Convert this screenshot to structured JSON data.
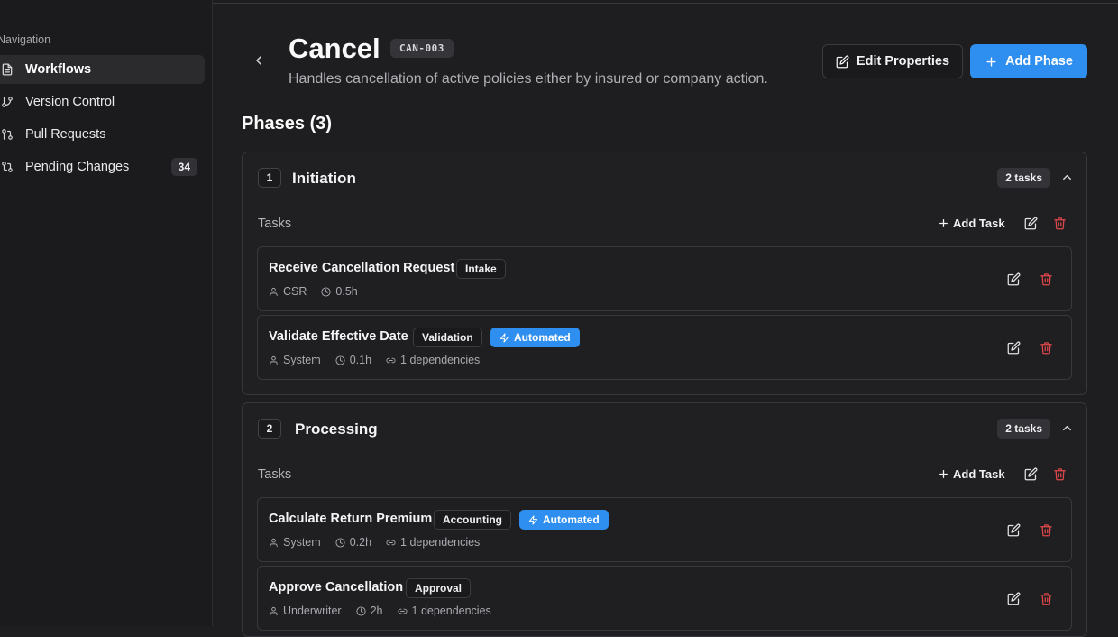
{
  "sidebar": {
    "heading": "Navigation",
    "items": [
      {
        "label": "Workflows",
        "icon": "document-icon",
        "active": true
      },
      {
        "label": "Version Control",
        "icon": "git-branch-icon"
      },
      {
        "label": "Pull Requests",
        "icon": "git-pull-request-icon"
      },
      {
        "label": "Pending Changes",
        "icon": "git-compare-icon",
        "badge": "34"
      }
    ]
  },
  "header": {
    "title": "Cancel",
    "code": "CAN-003",
    "description": "Handles cancellation of active policies either by insured or company action.",
    "edit_label": "Edit Properties",
    "add_label": "Add Phase"
  },
  "phases_title": "Phases (3)",
  "phases": [
    {
      "number": "1",
      "name": "Initiation",
      "count": "2 tasks",
      "tasks_label": "Tasks",
      "add_task_label": "Add Task",
      "tasks": [
        {
          "name": "Receive Cancellation Request",
          "tag": "Intake",
          "automated": false,
          "role": "CSR",
          "duration": "0.5h",
          "deps": ""
        },
        {
          "name": "Validate Effective Date",
          "tag": "Validation",
          "automated": true,
          "automated_label": "Automated",
          "role": "System",
          "duration": "0.1h",
          "deps": "1 dependencies"
        }
      ]
    },
    {
      "number": "2",
      "name": "Processing",
      "count": "2 tasks",
      "tasks_label": "Tasks",
      "add_task_label": "Add Task",
      "tasks": [
        {
          "name": "Calculate Return Premium",
          "tag": "Accounting",
          "automated": true,
          "automated_label": "Automated",
          "role": "System",
          "duration": "0.2h",
          "deps": "1 dependencies"
        },
        {
          "name": "Approve Cancellation",
          "tag": "Approval",
          "automated": false,
          "role": "Underwriter",
          "duration": "2h",
          "deps": "1 dependencies"
        }
      ]
    }
  ],
  "colors": {
    "accent": "#2f8ff0",
    "danger": "#e0474a",
    "background": "#1e1e20"
  }
}
